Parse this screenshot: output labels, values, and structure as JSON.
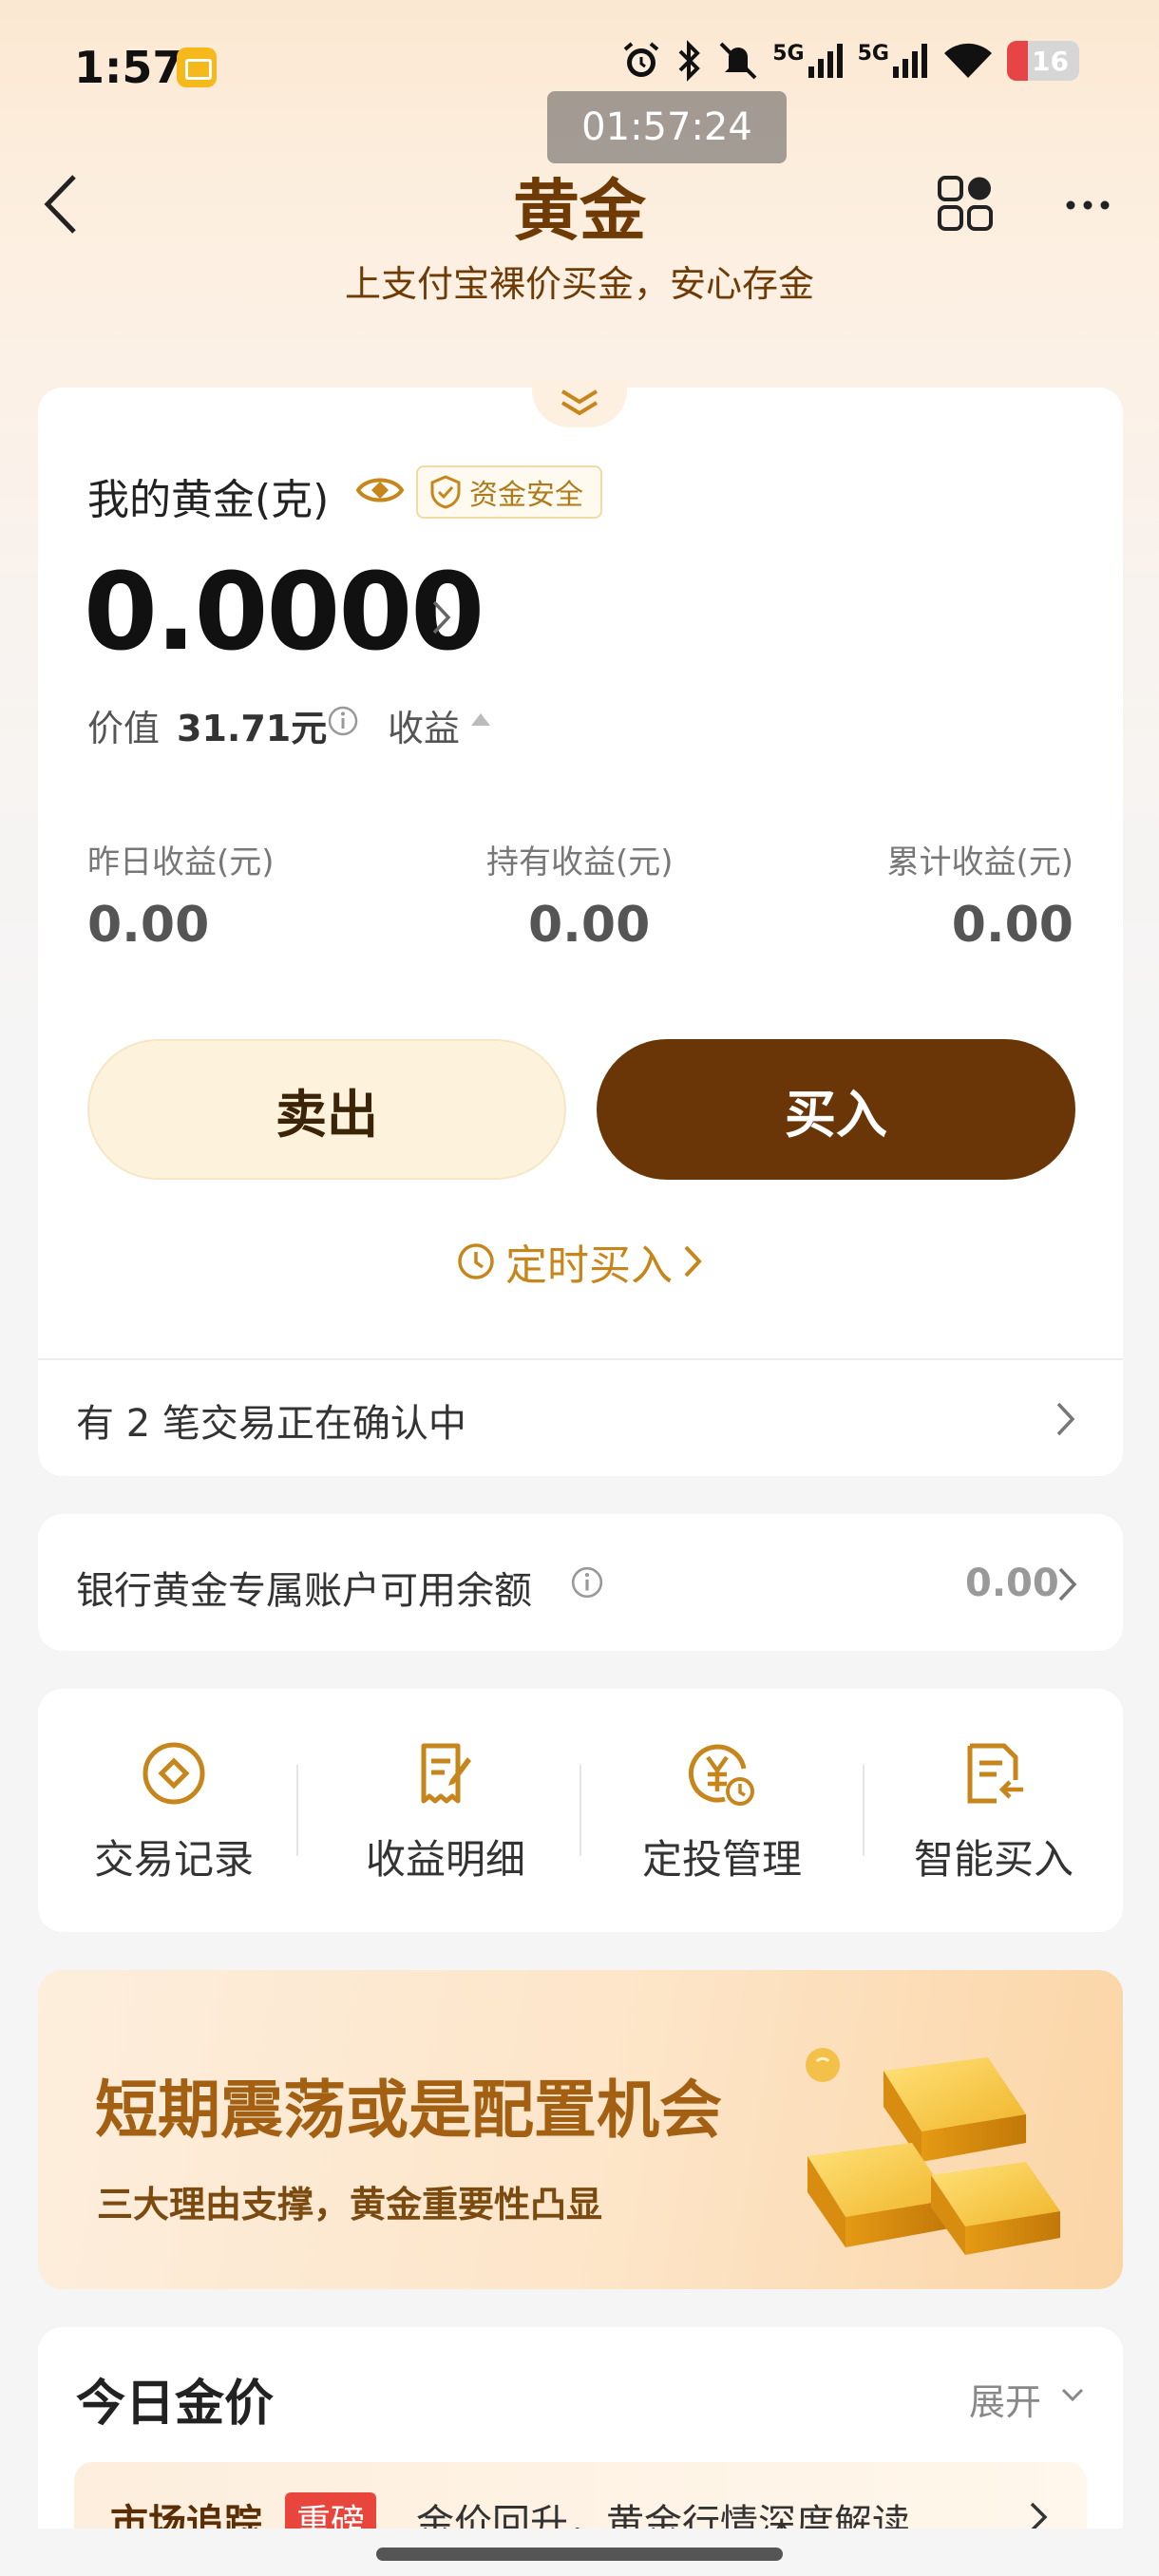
{
  "status_bar": {
    "time": "1:57",
    "signal_1": "5G",
    "signal_2": "5G",
    "battery": "16",
    "screen_record_timer": "01:57:24"
  },
  "nav": {
    "title": "黄金",
    "subtitle": "上支付宝裸价买金，安心存金"
  },
  "holdings": {
    "label": "我的黄金(克)",
    "safe_badge": "资金安全",
    "amount": "0.0000",
    "value_label": "价值",
    "value_amount": "31.71元",
    "earnings_label": "收益",
    "stats": [
      {
        "label": "昨日收益(元)",
        "value": "0.00"
      },
      {
        "label": "持有收益(元)",
        "value": "0.00"
      },
      {
        "label": "累计收益(元)",
        "value": "0.00"
      }
    ],
    "sell_label": "卖出",
    "buy_label": "买入",
    "timed_buy_label": "定时买入",
    "pending_text": "有 2 笔交易正在确认中"
  },
  "bank_account": {
    "label": "银行黄金专属账户可用余额",
    "value": "0.00"
  },
  "shortcuts": [
    {
      "label": "交易记录",
      "icon": "transaction-record-icon"
    },
    {
      "label": "收益明细",
      "icon": "earnings-detail-icon"
    },
    {
      "label": "定投管理",
      "icon": "auto-invest-icon"
    },
    {
      "label": "智能买入",
      "icon": "smart-buy-icon"
    }
  ],
  "banner": {
    "title": "短期震荡或是配置机会",
    "subtitle": "三大理由支撑，黄金重要性凸显"
  },
  "gold_price": {
    "title": "今日金价",
    "expand_label": "展开",
    "news_tag": "市场追踪",
    "news_badge": "重磅",
    "news_text": "金价回升，黄金行情深度解读"
  },
  "colors": {
    "brand_brown": "#6a3608",
    "gold_accent": "#c7861b",
    "sell_bg": "#fdf2dc"
  }
}
